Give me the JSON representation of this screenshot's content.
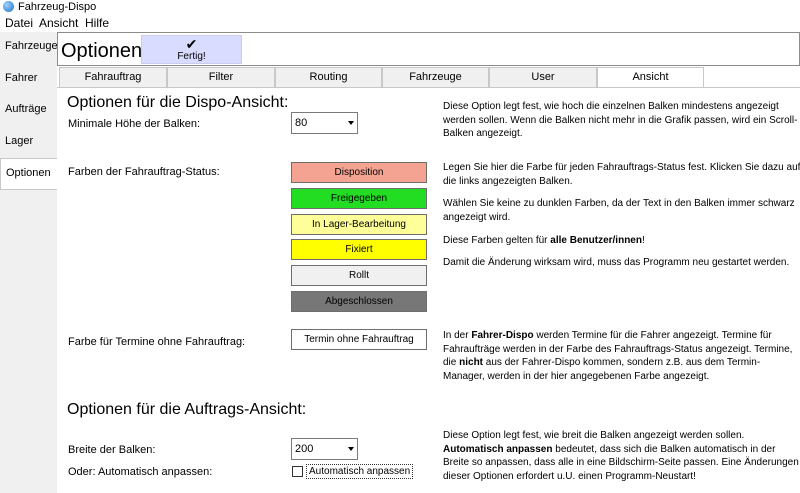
{
  "window": {
    "title": "Fahrzeug-Dispo"
  },
  "menu": [
    "Datei",
    "Ansicht",
    "Hilfe"
  ],
  "nav": [
    "Fahrzeuge",
    "Fahrer",
    "Aufträge",
    "Lager",
    "Optionen"
  ],
  "header": {
    "title": "Optionen:",
    "done_label": "Fertig!"
  },
  "tabs": [
    "Fahrauftrag",
    "Filter",
    "Routing",
    "Fahrzeuge",
    "User",
    "Ansicht"
  ],
  "dispo": {
    "section_title": "Optionen für die Dispo-Ansicht:",
    "min_height_label": "Minimale Höhe der Balken:",
    "min_height_value": "80",
    "min_height_desc": "Diese Option legt fest, wie hoch die einzelnen Balken mindestens angezeigt werden sollen. Wenn die Balken nicht mehr in die Grafik passen, wird ein Scroll-Balken angezeigt.",
    "colors_label": "Farben der Fahrauftrag-Status:",
    "status_buttons": [
      {
        "label": "Disposition",
        "color": "#f4a393"
      },
      {
        "label": "Freigegeben",
        "color": "#22dd22"
      },
      {
        "label": "In Lager-Bearbeitung",
        "color": "#ffff99"
      },
      {
        "label": "Fixiert",
        "color": "#ffff00"
      },
      {
        "label": "Rollt",
        "color": "#f0f0f0"
      },
      {
        "label": "Abgeschlossen",
        "color": "#777777"
      }
    ],
    "colors_desc_1": "Legen Sie hier die Farbe für jeden Fahrauftrags-Status fest. Klicken Sie dazu auf die links angezeigten Balken.",
    "colors_desc_2": "Wählen Sie keine zu dunklen Farben, da der Text in den Balken immer schwarz angezeigt wird.",
    "colors_desc_3_pre": "Diese Farben gelten für ",
    "colors_desc_3_bold": "alle Benutzer/innen",
    "colors_desc_3_post": "!",
    "colors_desc_4": "Damit die Änderung wirksam wird, muss das Programm neu gestartet werden.",
    "termine_label": "Farbe für Termine ohne Fahrauftrag:",
    "termine_button": "Termin ohne  Fahrauftrag",
    "termine_desc_pre": "In der ",
    "termine_desc_bold1": "Fahrer-Dispo",
    "termine_desc_mid": " werden Termine für die Fahrer angezeigt. Termine für Fahraufträge werden in der Farbe des Fahrauftrags-Status angezeigt. Termine, die ",
    "termine_desc_bold2": "nicht",
    "termine_desc_post": " aus der Fahrer-Dispo kommen, sondern z.B. aus dem Termin-Manager, werden in der hier angegebenen Farbe angezeigt."
  },
  "auftrag": {
    "section_title": "Optionen für die Auftrags-Ansicht:",
    "width_label": "Breite der Balken:",
    "width_value": "200",
    "auto_label": "Oder: Automatisch anpassen:",
    "auto_checkbox_label": "Automatisch anpassen",
    "desc_pre": "Diese Option legt fest, wie breit die Balken angezeigt werden sollen. ",
    "desc_bold": "Automatisch anpassen",
    "desc_post": " bedeutet, dass sich die Balken automatisch in der Breite so anpassen, dass alle in eine Bildschirm-Seite passen. Eine Änderungen dieser Optionen erfordert u.U. einen Programm-Neustart!"
  }
}
